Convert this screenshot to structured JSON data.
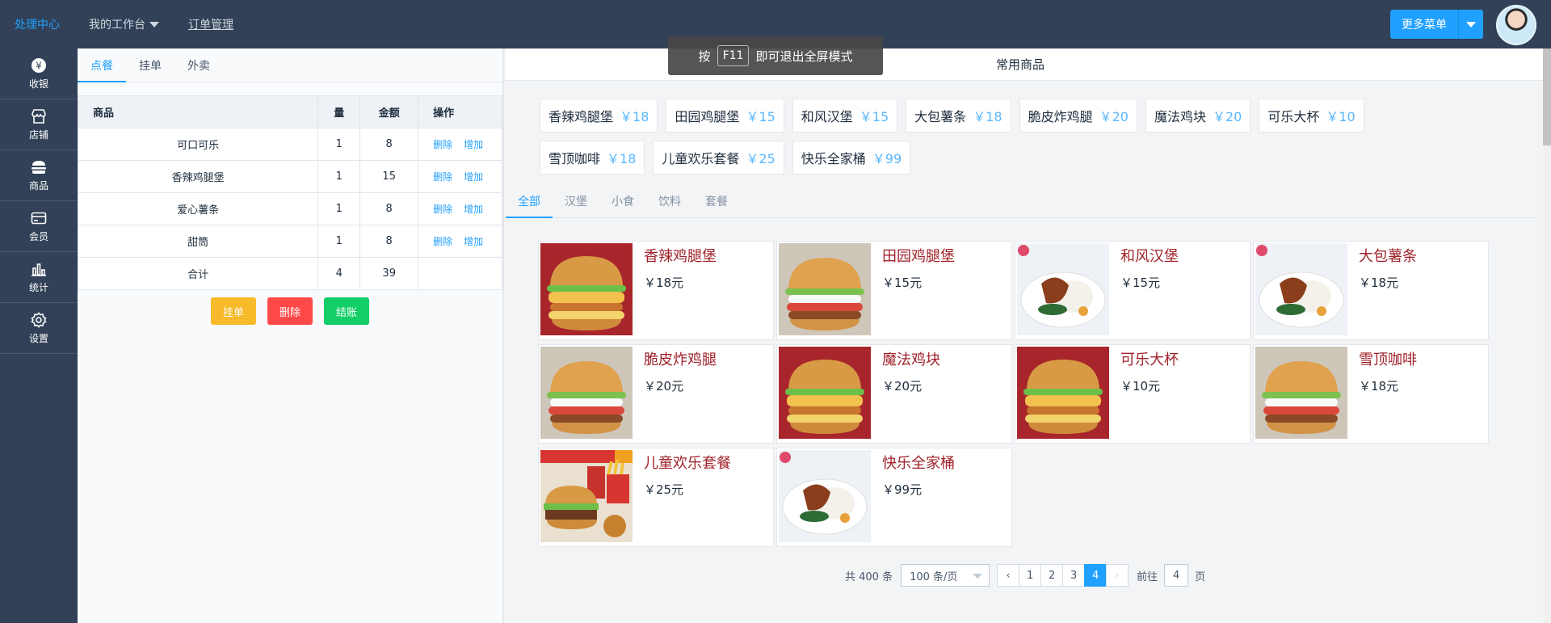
{
  "header": {
    "nav": [
      "处理中心",
      "我的工作台",
      "订单管理"
    ],
    "more_menu": "更多菜单"
  },
  "toast": {
    "prefix": "按",
    "key": "F11",
    "suffix": "即可退出全屏模式"
  },
  "sidebar": {
    "items": [
      {
        "label": "收银",
        "icon": "yen-icon"
      },
      {
        "label": "店铺",
        "icon": "store-icon"
      },
      {
        "label": "商品",
        "icon": "burger-icon"
      },
      {
        "label": "会员",
        "icon": "card-icon"
      },
      {
        "label": "统计",
        "icon": "chart-icon"
      },
      {
        "label": "设置",
        "icon": "gear-icon"
      }
    ]
  },
  "left": {
    "tabs": [
      "点餐",
      "挂单",
      "外卖"
    ],
    "table": {
      "headers": [
        "商品",
        "量",
        "金额",
        "操作"
      ],
      "rows": [
        {
          "name": "可口可乐",
          "qty": "1",
          "amount": "8"
        },
        {
          "name": "香辣鸡腿堡",
          "qty": "1",
          "amount": "15"
        },
        {
          "name": "爱心薯条",
          "qty": "1",
          "amount": "8"
        },
        {
          "name": "甜筒",
          "qty": "1",
          "amount": "8"
        }
      ],
      "total": {
        "label": "合计",
        "qty": "4",
        "amount": "39"
      },
      "op_delete": "删除",
      "op_add": "增加"
    },
    "buttons": {
      "hold": "挂单",
      "delete": "删除",
      "checkout": "结账"
    }
  },
  "right": {
    "title": "常用商品",
    "common": [
      {
        "name": "香辣鸡腿堡",
        "price": "￥18"
      },
      {
        "name": "田园鸡腿堡",
        "price": "￥15"
      },
      {
        "name": "和风汉堡",
        "price": "￥15"
      },
      {
        "name": "大包薯条",
        "price": "￥18"
      },
      {
        "name": "脆皮炸鸡腿",
        "price": "￥20"
      },
      {
        "name": "魔法鸡块",
        "price": "￥20"
      },
      {
        "name": "可乐大杯",
        "price": "￥10"
      },
      {
        "name": "雪顶咖啡",
        "price": "￥18"
      },
      {
        "name": "儿童欢乐套餐",
        "price": "￥25"
      },
      {
        "name": "快乐全家桶",
        "price": "￥99"
      }
    ],
    "categories": [
      "全部",
      "汉堡",
      "小食",
      "饮料",
      "套餐"
    ],
    "products": [
      {
        "name": "香辣鸡腿堡",
        "price": "￥18元",
        "img": "burger"
      },
      {
        "name": "田园鸡腿堡",
        "price": "￥15元",
        "img": "burger2"
      },
      {
        "name": "和风汉堡",
        "price": "￥15元",
        "img": "rice"
      },
      {
        "name": "大包薯条",
        "price": "￥18元",
        "img": "rice"
      },
      {
        "name": "脆皮炸鸡腿",
        "price": "￥20元",
        "img": "burger2"
      },
      {
        "name": "魔法鸡块",
        "price": "￥20元",
        "img": "burger"
      },
      {
        "name": "可乐大杯",
        "price": "￥10元",
        "img": "burger"
      },
      {
        "name": "雪顶咖啡",
        "price": "￥18元",
        "img": "burger2"
      },
      {
        "name": "儿童欢乐套餐",
        "price": "￥25元",
        "img": "combo"
      },
      {
        "name": "快乐全家桶",
        "price": "￥99元",
        "img": "rice"
      }
    ],
    "pager": {
      "total": "共 400 条",
      "page_size": "100 条/页",
      "pages": [
        "1",
        "2",
        "3",
        "4"
      ],
      "current": "4",
      "goto_prefix": "前往",
      "goto_value": "4",
      "goto_suffix": "页"
    }
  },
  "colors": {
    "accent": "#20a0ff",
    "hold": "#f7ba2a",
    "delete": "#ff4949",
    "checkout": "#13ce66",
    "sidebar": "#324157"
  }
}
